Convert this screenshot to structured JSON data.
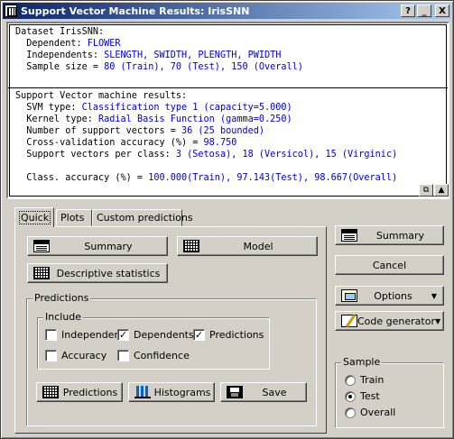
{
  "window": {
    "title": "Support Vector Machine Results: IrisSNN",
    "help_btn": "?",
    "min_btn": "_",
    "close_btn": "X"
  },
  "output": {
    "lines1": [
      {
        "label": "Dataset IrisSNN:",
        "value": ""
      },
      {
        "label": "  Dependent: ",
        "value": "FLOWER"
      },
      {
        "label": "  Independents: ",
        "value": "SLENGTH, SWIDTH, PLENGTH, PWIDTH"
      },
      {
        "label": "  Sample size = ",
        "value": "80 (Train), 70 (Test), 150 (Overall)"
      }
    ],
    "lines2": [
      {
        "label": "Support Vector machine results:",
        "value": ""
      },
      {
        "label": "  SVM type: ",
        "value": "Classification type 1 (capacity=5.000)"
      },
      {
        "label": "  Kernel type: ",
        "value": "Radial Basis Function (gamma=0.250)"
      },
      {
        "label": "  Number of support vectors = ",
        "value": "36 (25 bounded)"
      },
      {
        "label": "  Cross-validation accuracy (%) = ",
        "value": "98.750"
      },
      {
        "label": "  Support vectors per class: ",
        "value": "3 (Setosa), 18 (Versicol), 15 (Virginic)"
      },
      {
        "label": "",
        "value": ""
      },
      {
        "label": "  Class. accuracy (%) = ",
        "value": "100.000(Train), 97.143(Test), 98.667(Overall)"
      }
    ]
  },
  "tabs": [
    {
      "label": "Quick",
      "active": true
    },
    {
      "label": "Plots",
      "active": false
    },
    {
      "label": "Custom predictions",
      "active": false
    }
  ],
  "quick": {
    "summary": "Summary",
    "model": "Model",
    "descriptive": "Descriptive statistics",
    "predictions_group": "Predictions",
    "include_group": "Include",
    "independents": "Independents",
    "dependents": "Dependents",
    "predictions_cb": "Predictions",
    "accuracy": "Accuracy",
    "confidence": "Confidence",
    "predictions_btn": "Predictions",
    "histograms_btn": "Histograms",
    "save_btn": "Save"
  },
  "checks": {
    "independents": false,
    "dependents": true,
    "predictions": true,
    "accuracy": false,
    "confidence": false
  },
  "right": {
    "summary": "Summary",
    "cancel": "Cancel",
    "options": "Options",
    "code_generator": "Code generator",
    "sample_group": "Sample",
    "train": "Train",
    "test": "Test",
    "overall": "Overall",
    "selected_sample": "Test"
  }
}
